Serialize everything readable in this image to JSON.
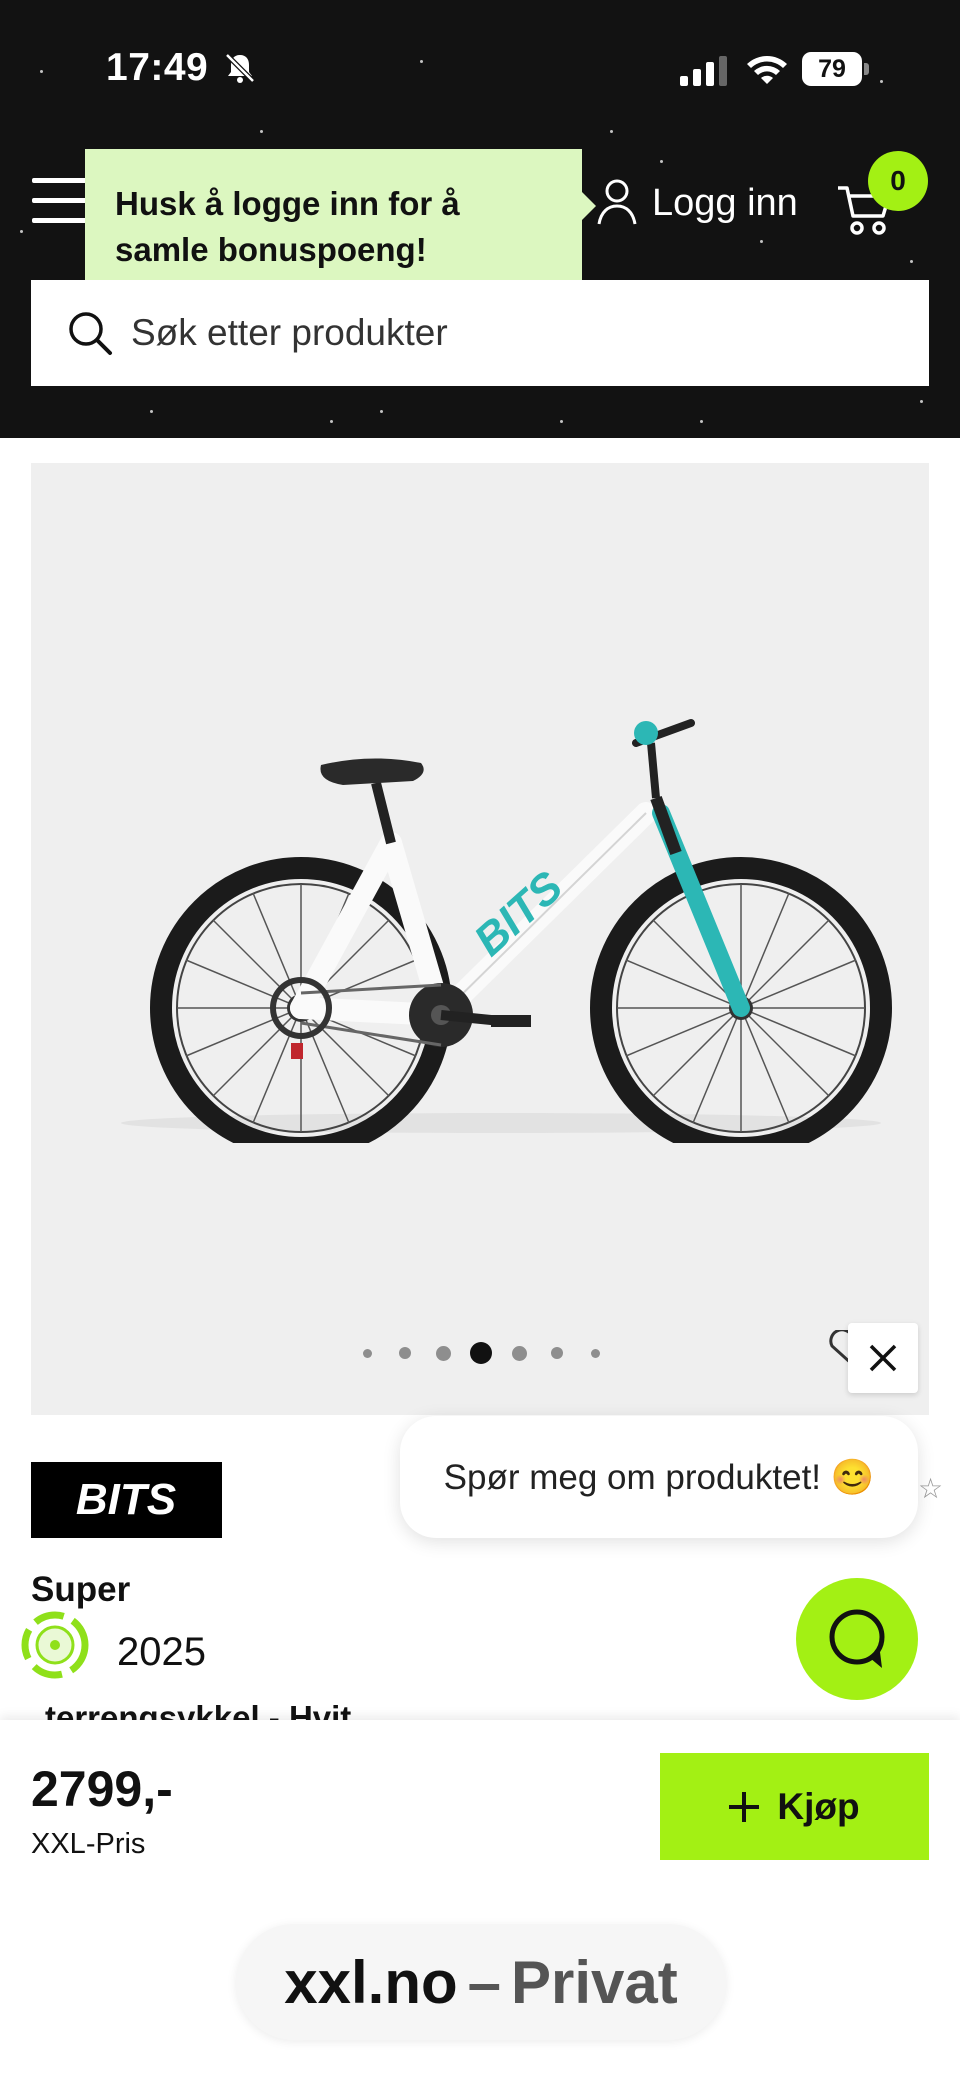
{
  "status_bar": {
    "time": "17:49",
    "battery": "79",
    "icons": [
      "bell-slash-icon",
      "signal-icon",
      "wifi-icon",
      "battery-icon"
    ]
  },
  "header": {
    "menu_icon": "hamburger-menu-icon",
    "tooltip": "Husk å logge inn for å samle bonuspoeng!",
    "login_label": "Logg inn",
    "cart_count": "0",
    "accent_color": "#a3f014",
    "background_color": "#121212"
  },
  "search": {
    "placeholder": "Søk etter produkter"
  },
  "product": {
    "image_dots": 7,
    "active_dot": 3,
    "brand": "BITS",
    "title_line_1": "Super",
    "title_line_2": "2025",
    "title_line_3": "terrengsykkel - Hvit",
    "price": "2799,-",
    "price_label": "XXL-Pris",
    "buy_label": "Kjøp"
  },
  "chat": {
    "bubble_text": "Spør meg om produktet! 😊"
  },
  "browser": {
    "domain": "xxl.no",
    "separator": "–",
    "mode": "Privat"
  }
}
